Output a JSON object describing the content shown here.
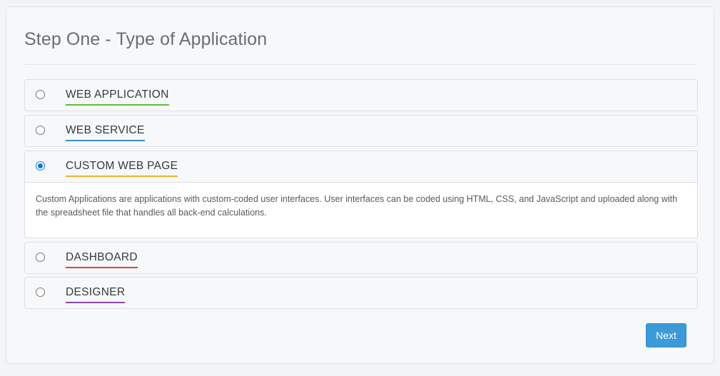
{
  "page": {
    "title": "Step One - Type of Application"
  },
  "options": [
    {
      "label": "WEB APPLICATION",
      "selected": false,
      "underline_color": "#5bbd3c"
    },
    {
      "label": "WEB SERVICE",
      "selected": false,
      "underline_color": "#3a8fc9"
    },
    {
      "label": "CUSTOM WEB PAGE",
      "selected": true,
      "underline_color": "#f0b232",
      "description": "Custom Applications are applications with custom-coded user interfaces. User interfaces can be coded using HTML, CSS, and JavaScript and uploaded along with the spreadsheet file that handles all back-end calculations."
    },
    {
      "label": "DASHBOARD",
      "selected": false,
      "underline_color": "#d9453b"
    },
    {
      "label": "DESIGNER",
      "selected": false,
      "underline_color": "#8e44ad"
    }
  ],
  "actions": {
    "next_label": "Next"
  },
  "colors": {
    "primary": "#3c9ad9",
    "radio_checked": "#0a75e0"
  }
}
